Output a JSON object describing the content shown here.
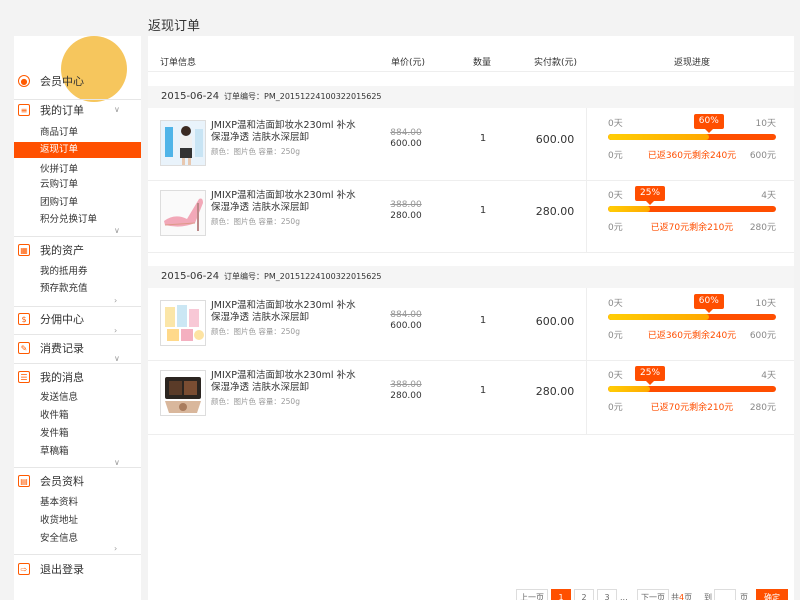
{
  "page_title": "返现订单",
  "sidebar": {
    "member_center": "会员中心",
    "my_orders": "我的订单",
    "order_items": [
      "商品订单",
      "返现订单",
      "伙拼订单",
      "云购订单",
      "团购订单",
      "积分兑换订单"
    ],
    "my_assets": "我的资产",
    "asset_items": [
      "我的抵用券",
      "预存款充值"
    ],
    "commission": "分佣中心",
    "consumption": "消费记录",
    "my_messages": "我的消息",
    "message_items": [
      "发送信息",
      "收件箱",
      "发件箱",
      "草稿箱"
    ],
    "member_profile": "会员资料",
    "profile_items": [
      "基本资料",
      "收货地址",
      "安全信息"
    ],
    "logout": "退出登录"
  },
  "table_header": {
    "info": "订单信息",
    "unit_price": "单价(元)",
    "quantity": "数量",
    "paid": "实付款(元)",
    "progress": "返现进度"
  },
  "orders": [
    {
      "date": "2015-06-24",
      "order_no": "订单编号：PM_20151224100322015625",
      "items": [
        {
          "name": "JMIXP温和洁面卸妆水230ml 补水保湿净透 洁肤水深层卸",
          "attrs": "颜色：图片色   容量：250g",
          "price_old": "884.00",
          "price_new": "600.00",
          "qty": "1",
          "paid": "600.00",
          "start_day": "0天",
          "end_day": "10天",
          "percent_label": "60%",
          "percent": 0.6,
          "start_amount": "0元",
          "status": "已返360元剩余240元",
          "end_amount": "600元"
        },
        {
          "name": "JMIXP温和洁面卸妆水230ml 补水保湿净透 洁肤水深层卸",
          "attrs": "颜色：图片色   容量：250g",
          "price_old": "388.00",
          "price_new": "280.00",
          "qty": "1",
          "paid": "280.00",
          "start_day": "0天",
          "end_day": "4天",
          "percent_label": "25%",
          "percent": 0.25,
          "start_amount": "0元",
          "status": "已返70元剩余210元",
          "end_amount": "280元"
        }
      ]
    },
    {
      "date": "2015-06-24",
      "order_no": "订单编号：PM_20151224100322015625",
      "items": [
        {
          "name": "JMIXP温和洁面卸妆水230ml 补水保湿净透 洁肤水深层卸",
          "attrs": "颜色：图片色   容量：250g",
          "price_old": "884.00",
          "price_new": "600.00",
          "qty": "1",
          "paid": "600.00",
          "start_day": "0天",
          "end_day": "10天",
          "percent_label": "60%",
          "percent": 0.6,
          "start_amount": "0元",
          "status": "已返360元剩余240元",
          "end_amount": "600元"
        },
        {
          "name": "JMIXP温和洁面卸妆水230ml 补水保湿净透 洁肤水深层卸",
          "attrs": "颜色：图片色   容量：250g",
          "price_old": "388.00",
          "price_new": "280.00",
          "qty": "1",
          "paid": "280.00",
          "start_day": "0天",
          "end_day": "4天",
          "percent_label": "25%",
          "percent": 0.25,
          "start_amount": "0元",
          "status": "已返70元剩余210元",
          "end_amount": "280元"
        }
      ]
    }
  ],
  "pagination": {
    "prev": "上一页",
    "pages": [
      "1",
      "2",
      "3"
    ],
    "ellipsis": "...",
    "next": "下一页",
    "total_prefix": "共",
    "total_pages": "4",
    "total_suffix": "页",
    "goto_label": "到",
    "page_unit": "页",
    "confirm": "确定"
  },
  "colors": {
    "accent": "#ff5000",
    "progress_start": "#ffce05",
    "progress_end": "#ff4e00",
    "avatar": "#f6c65d"
  }
}
